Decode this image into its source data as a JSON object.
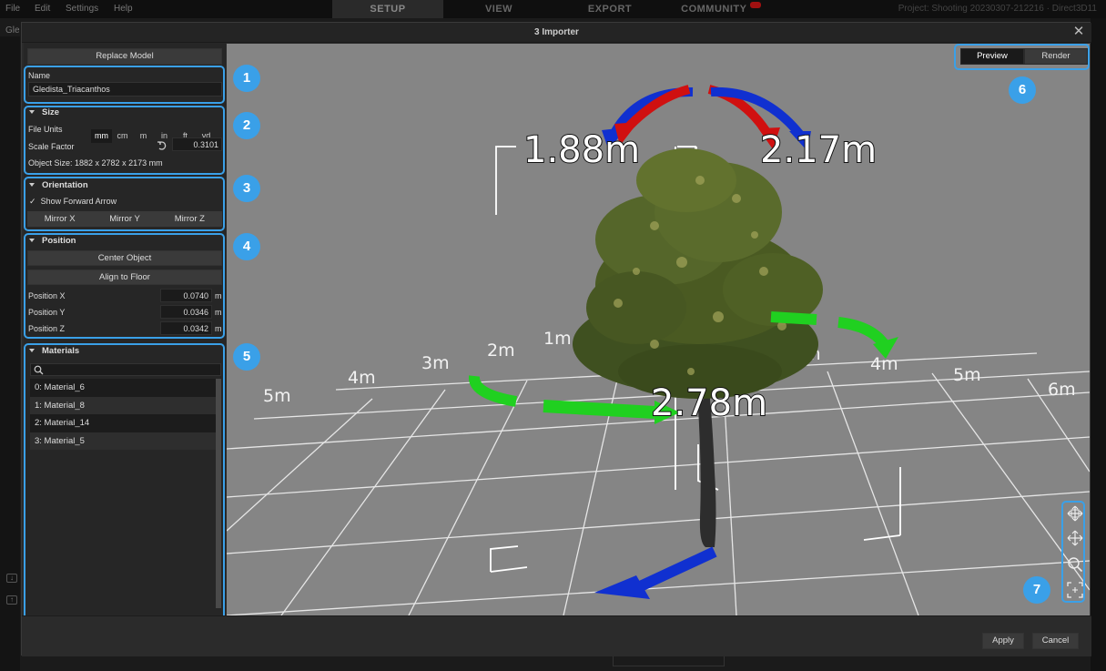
{
  "menubar": {
    "items": [
      "File",
      "Edit",
      "Settings",
      "Help"
    ],
    "tabs": [
      "SETUP",
      "VIEW",
      "EXPORT",
      "COMMUNITY"
    ],
    "project": "Project: Shooting 20230307-212216 · Direct3D11"
  },
  "background": {
    "side_label": "Gle"
  },
  "dialog": {
    "title": "3 Importer",
    "close_glyph": "✕",
    "replace_model": "Replace Model",
    "name_label": "Name",
    "name_value": "Gledista_Triacanthos",
    "size": {
      "header": "Size",
      "file_units_label": "File Units",
      "units": [
        "mm",
        "cm",
        "m",
        "in",
        "ft",
        "yd"
      ],
      "selected_unit": "mm",
      "scale_factor_label": "Scale Factor",
      "scale_factor_value": "0.3101",
      "object_size": "Object Size: 1882 x 2782 x 2173 mm"
    },
    "orientation": {
      "header": "Orientation",
      "show_forward_arrow": "Show Forward Arrow",
      "check_glyph": "✓",
      "mirror_x": "Mirror X",
      "mirror_y": "Mirror Y",
      "mirror_z": "Mirror Z"
    },
    "position": {
      "header": "Position",
      "center_object": "Center Object",
      "align_to_floor": "Align to Floor",
      "pos_x_label": "Position X",
      "pos_x_value": "0.0740",
      "pos_y_label": "Position Y",
      "pos_y_value": "0.0346",
      "pos_z_label": "Position Z",
      "pos_z_value": "0.0342",
      "unit": "m"
    },
    "materials": {
      "header": "Materials",
      "items": [
        "0: Material_6",
        "1: Material_8",
        "2: Material_14",
        "3: Material_5"
      ]
    },
    "viewport": {
      "preview": "Preview",
      "render": "Render",
      "mode": "Preview",
      "dim_left": "1.88m",
      "dim_right": "2.17m",
      "dim_height": "2.78m",
      "grid_labels_left": [
        "5m",
        "4m",
        "3m",
        "2m",
        "1m"
      ],
      "grid_labels_right": [
        "3m",
        "4m",
        "5m",
        "6m"
      ],
      "tools": [
        "move-icon",
        "pan-icon",
        "zoom-icon",
        "frame-icon"
      ]
    },
    "apply": "Apply",
    "cancel": "Cancel"
  },
  "callouts": [
    "1",
    "2",
    "3",
    "4",
    "5",
    "6",
    "7"
  ],
  "colors": {
    "accent": "#3aa0e8",
    "viewport_bg": "#858585",
    "arrow_red": "#d01010",
    "arrow_blue": "#1020d0",
    "arrow_green": "#20d020"
  }
}
